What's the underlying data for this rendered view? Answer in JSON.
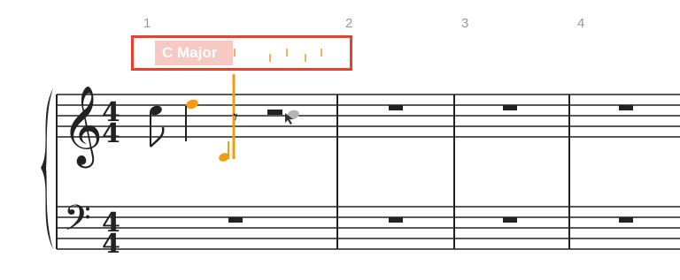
{
  "measures": [
    "1",
    "2",
    "3",
    "4"
  ],
  "chord_input": {
    "value": "C Major",
    "accent_color": "#e8412c",
    "highlight_color": "#f6c9c3"
  },
  "clefs": [
    "treble-clef",
    "bass-clef"
  ],
  "time_signature": {
    "numerator": "4",
    "denominator": "4"
  },
  "colors": {
    "selection": "#f39c12",
    "staff": "#222222",
    "ghost_note": "#b5b5b5"
  }
}
